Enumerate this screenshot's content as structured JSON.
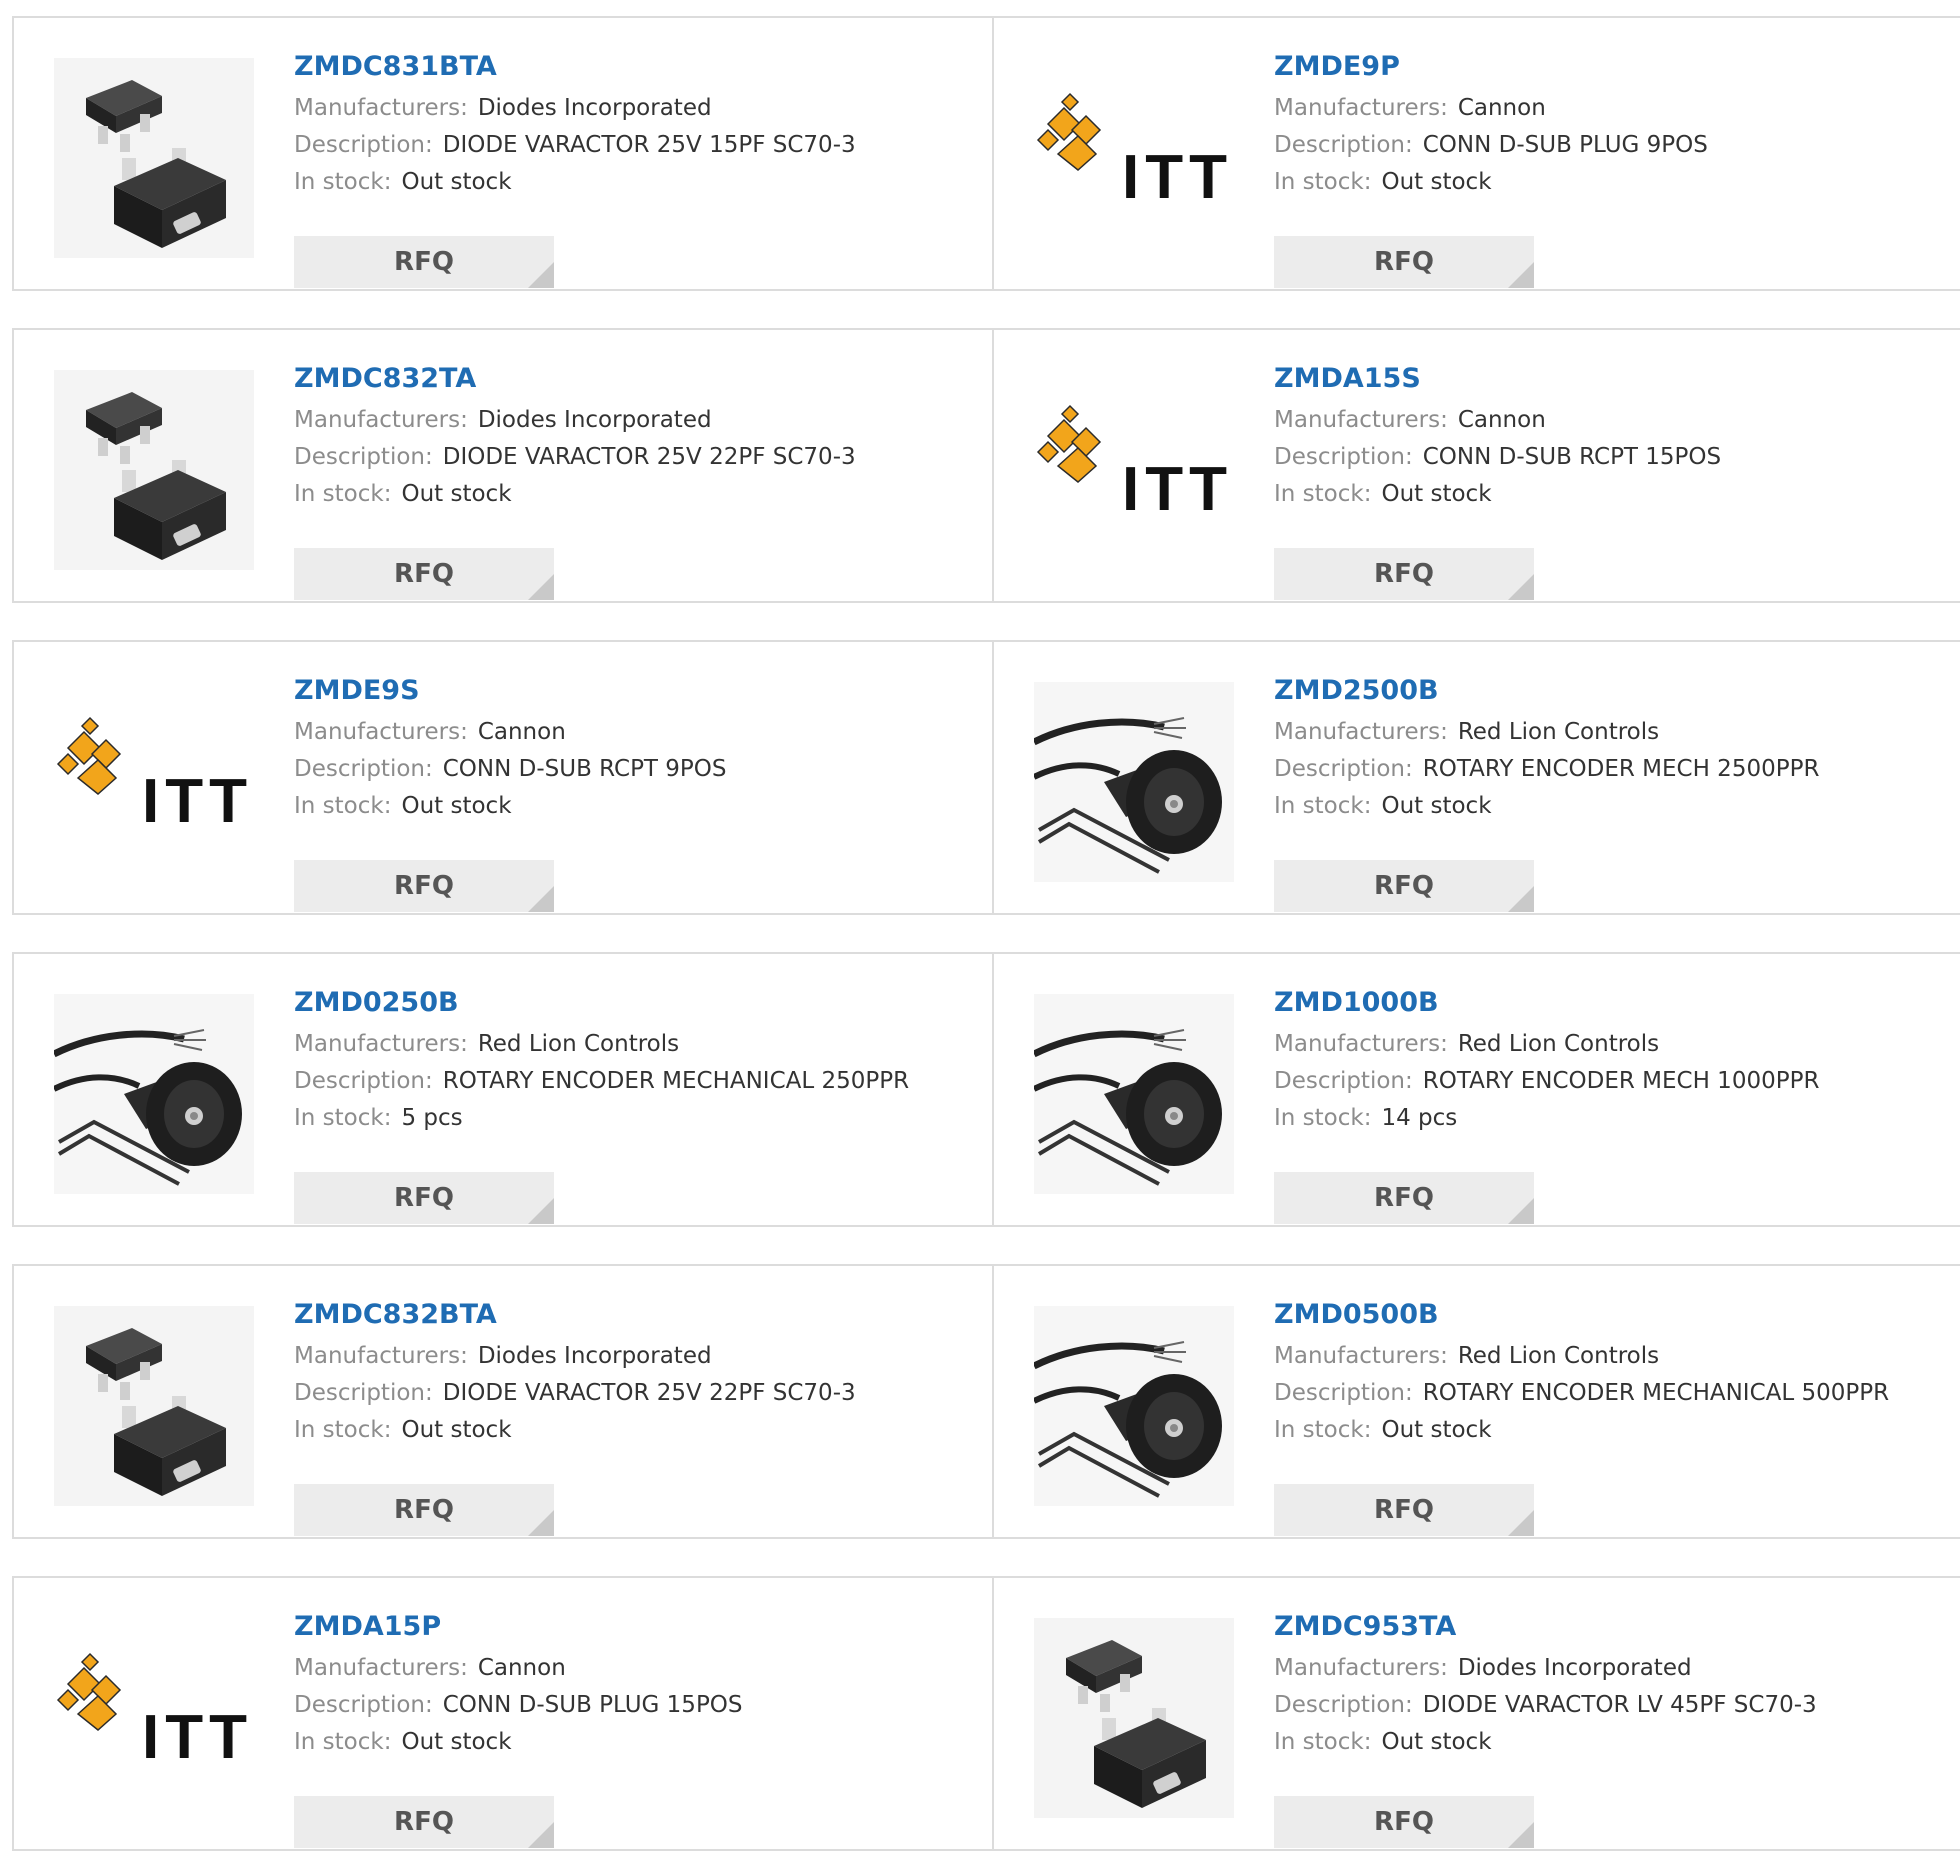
{
  "labels": {
    "manufacturers": "Manufacturers:",
    "description": "Description:",
    "in_stock": "In stock:",
    "rfq": "RFQ"
  },
  "colors": {
    "title": "#1f6cb3",
    "logo_gold": "#f2a51b",
    "border": "#dcdcdc",
    "button_bg": "#ececec"
  },
  "products": [
    {
      "part": "ZMDC831BTA",
      "manufacturer": "Diodes Incorporated",
      "description": "DIODE VARACTOR 25V 15PF SC70-3",
      "stock": "Out stock",
      "image": "sc70-diode-icon"
    },
    {
      "part": "ZMDE9P",
      "manufacturer": "Cannon",
      "description": "CONN D-SUB PLUG 9POS",
      "stock": "Out stock",
      "image": "itt-logo",
      "logo_text": "ITT"
    },
    {
      "part": "ZMDC832TA",
      "manufacturer": "Diodes Incorporated",
      "description": "DIODE VARACTOR 25V 22PF SC70-3",
      "stock": "Out stock",
      "image": "sc70-diode-icon"
    },
    {
      "part": "ZMDA15S",
      "manufacturer": "Cannon",
      "description": "CONN D-SUB RCPT 15POS",
      "stock": "Out stock",
      "image": "itt-logo",
      "logo_text": "ITT"
    },
    {
      "part": "ZMDE9S",
      "manufacturer": "Cannon",
      "description": "CONN D-SUB RCPT 9POS",
      "stock": "Out stock",
      "image": "itt-logo",
      "logo_text": "ITT"
    },
    {
      "part": "ZMD2500B",
      "manufacturer": "Red Lion Controls",
      "description": "ROTARY ENCODER MECH 2500PPR",
      "stock": "Out stock",
      "image": "rotary-encoder-icon"
    },
    {
      "part": "ZMD0250B",
      "manufacturer": "Red Lion Controls",
      "description": "ROTARY ENCODER MECHANICAL 250PPR",
      "stock": "5 pcs",
      "image": "rotary-encoder-icon"
    },
    {
      "part": "ZMD1000B",
      "manufacturer": "Red Lion Controls",
      "description": "ROTARY ENCODER MECH 1000PPR",
      "stock": "14 pcs",
      "image": "rotary-encoder-icon"
    },
    {
      "part": "ZMDC832BTA",
      "manufacturer": "Diodes Incorporated",
      "description": "DIODE VARACTOR 25V 22PF SC70-3",
      "stock": "Out stock",
      "image": "sc70-diode-icon"
    },
    {
      "part": "ZMD0500B",
      "manufacturer": "Red Lion Controls",
      "description": "ROTARY ENCODER MECHANICAL 500PPR",
      "stock": "Out stock",
      "image": "rotary-encoder-icon"
    },
    {
      "part": "ZMDA15P",
      "manufacturer": "Cannon",
      "description": "CONN D-SUB PLUG 15POS",
      "stock": "Out stock",
      "image": "itt-logo",
      "logo_text": "ITT"
    },
    {
      "part": "ZMDC953TA",
      "manufacturer": "Diodes Incorporated",
      "description": "DIODE VARACTOR LV 45PF SC70-3",
      "stock": "Out stock",
      "image": "sc70-diode-icon"
    }
  ]
}
